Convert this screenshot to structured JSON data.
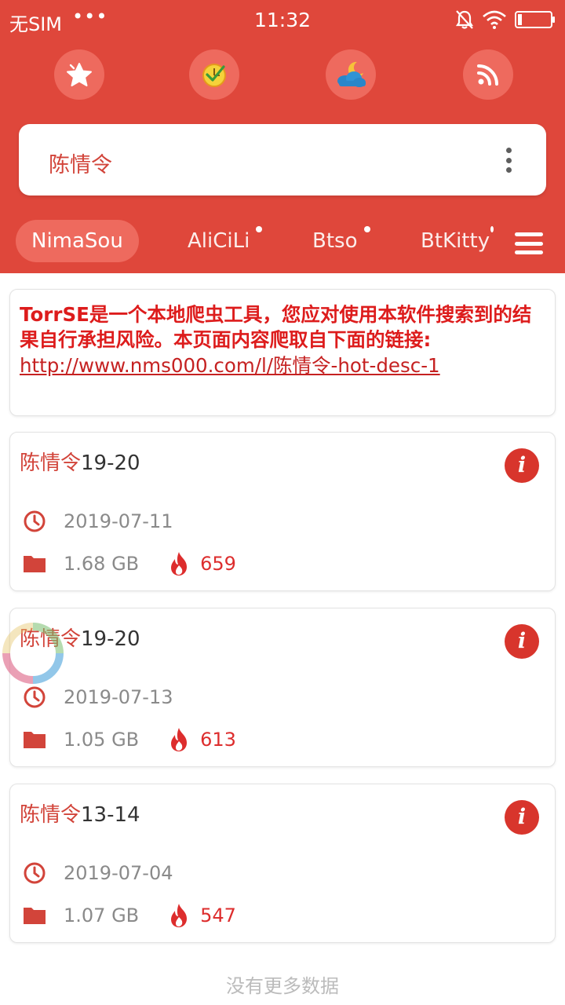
{
  "status": {
    "carrier": "无SIM",
    "dots": "•••",
    "time": "11:32"
  },
  "quick_actions": [
    {
      "icon": "star-icon"
    },
    {
      "icon": "clock-check-icon"
    },
    {
      "icon": "night-cloud-icon"
    },
    {
      "icon": "rss-icon"
    }
  ],
  "search": {
    "query": "陈情令"
  },
  "tabs": [
    {
      "label": "NimaSou",
      "active": true
    },
    {
      "label": "AliCiLi",
      "dot": true
    },
    {
      "label": "Btso",
      "dot": true
    },
    {
      "label": "BtKitty",
      "dot": true
    }
  ],
  "notice": {
    "text": "TorrSE是一个本地爬虫工具，您应对使用本软件搜索到的结果自行承担风险。本页面内容爬取自下面的链接:",
    "link": "http://www.nms000.com/l/陈情令-hot-desc-1"
  },
  "results": [
    {
      "title_highlight": "陈情令",
      "title_rest": "19-20",
      "date": "2019-07-11",
      "size": "1.68 GB",
      "heat": "659"
    },
    {
      "title_highlight": "陈情令",
      "title_rest": "19-20",
      "date": "2019-07-13",
      "size": "1.05 GB",
      "heat": "613"
    },
    {
      "title_highlight": "陈情令",
      "title_rest": "13-14",
      "date": "2019-07-04",
      "size": "1.07 GB",
      "heat": "547"
    }
  ],
  "footer": {
    "text": "没有更多数据"
  },
  "colors": {
    "header": "#df473b",
    "accent": "#d2443a",
    "heat": "#dd2d2d",
    "notice_text": "#dd1c1c"
  }
}
